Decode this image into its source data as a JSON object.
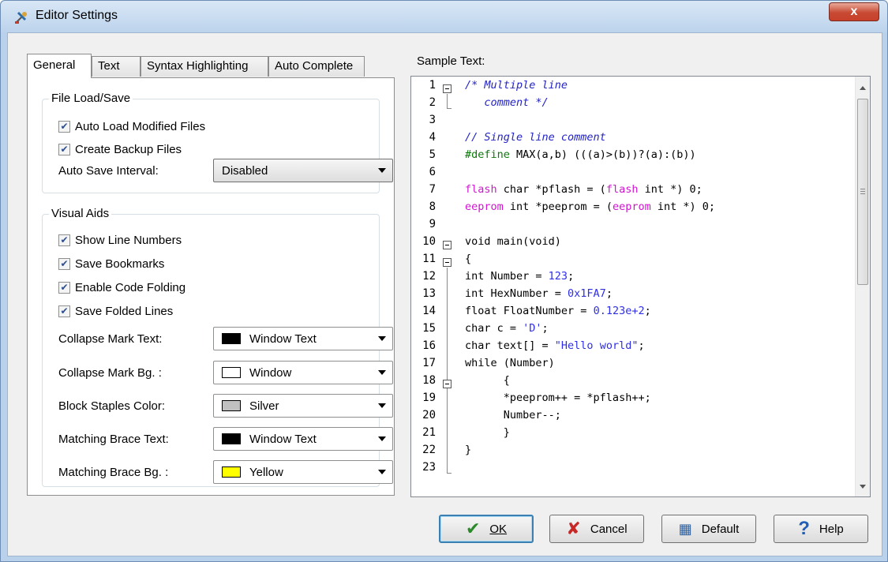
{
  "window": {
    "title": "Editor Settings",
    "close_symbol": "x"
  },
  "tabs": [
    {
      "label": "General",
      "active": true
    },
    {
      "label": "Text",
      "active": false
    },
    {
      "label": "Syntax Highlighting",
      "active": false
    },
    {
      "label": "Auto Complete",
      "active": false
    }
  ],
  "file_load_save": {
    "title": "File Load/Save",
    "auto_load_label": "Auto Load Modified Files",
    "auto_load_checked": true,
    "create_backup_label": "Create Backup Files",
    "create_backup_checked": true,
    "auto_save_label": "Auto Save Interval:",
    "auto_save_value": "Disabled"
  },
  "visual_aids": {
    "title": "Visual Aids",
    "show_line_numbers_label": "Show Line Numbers",
    "save_bookmarks_label": "Save Bookmarks",
    "enable_code_folding_label": "Enable Code Folding",
    "save_folded_lines_label": "Save Folded Lines",
    "collapse_mark_text_label": "Collapse Mark Text:",
    "collapse_mark_text_value": "Window Text",
    "collapse_mark_text_color": "#000000",
    "collapse_mark_bg_label": "Collapse Mark Bg. :",
    "collapse_mark_bg_value": "Window",
    "collapse_mark_bg_color": "#ffffff",
    "block_staples_label": "Block Staples Color:",
    "block_staples_value": "Silver",
    "block_staples_color": "#c0c0c0",
    "matching_brace_text_label": "Matching Brace Text:",
    "matching_brace_text_value": "Window Text",
    "matching_brace_text_color": "#000000",
    "matching_brace_bg_label": "Matching Brace Bg. :",
    "matching_brace_bg_value": "Yellow",
    "matching_brace_bg_color": "#ffff00"
  },
  "sample": {
    "label": "Sample Text:",
    "line_numbers": [
      "1",
      "2",
      "3",
      "4",
      "5",
      "6",
      "7",
      "8",
      "9",
      "10",
      "11",
      "12",
      "13",
      "14",
      "15",
      "16",
      "17",
      "18",
      "19",
      "20",
      "21",
      "22",
      "23"
    ],
    "code": {
      "l1": "/* Multiple line",
      "l2": "   comment */",
      "l4": "// Single line comment",
      "l5a": "#define",
      "l5b": " MAX(a,b) (((a)>(b))?(a):(b))",
      "l7a": "flash",
      "l7b": " char *pflash = (",
      "l7c": "flash",
      "l7d": " int *) 0;",
      "l8a": "eeprom",
      "l8b": " int *peeprom = (",
      "l8c": "eeprom",
      "l8d": " int *) 0;",
      "l10": "void main(void)",
      "l11": "{",
      "l12a": "int Number = ",
      "l12b": "123",
      "l12c": ";",
      "l13a": "int HexNumber = ",
      "l13b": "0x1FA7",
      "l13c": ";",
      "l14a": "float FloatNumber = ",
      "l14b": "0.123e+2",
      "l14c": ";",
      "l15a": "char c = ",
      "l15b": "'D'",
      "l15c": ";",
      "l16a": "char text[] = ",
      "l16b": "\"Hello world\"",
      "l16c": ";",
      "l17": "while (Number)",
      "l18": "      {",
      "l19": "      *peeprom++ = *pflash++;",
      "l20": "      Number--;",
      "l21": "      }",
      "l22": "}"
    }
  },
  "buttons": {
    "ok": "OK",
    "cancel": "Cancel",
    "default": "Default",
    "help": "Help"
  },
  "colors": {
    "comment": "#2323c6",
    "preprocessor": "#0a7a0a",
    "memory_keyword": "#d016d0",
    "number": "#2f2fe6"
  }
}
